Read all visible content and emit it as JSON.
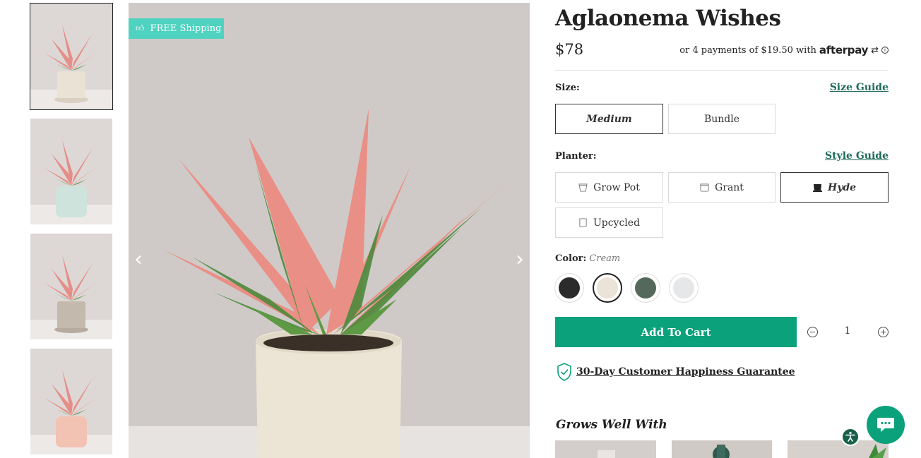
{
  "gallery": {
    "thumbnails": [
      {
        "planter_color": "#e9e2d5",
        "selected": true
      },
      {
        "planter_color": "#cfe3dd",
        "selected": false
      },
      {
        "planter_color": "#c3b9ad",
        "selected": false
      },
      {
        "planter_color": "#f2c2b2",
        "selected": false
      }
    ],
    "main_badge": "FREE Shipping",
    "prev_arrow": "‹",
    "next_arrow": "›"
  },
  "product": {
    "title": "Aglaonema Wishes",
    "price": "$78",
    "afterpay": {
      "text": "or 4 payments of $19.50 with",
      "logo": "afterpay",
      "arrows_glyph": "⇄",
      "info_glyph": "i"
    }
  },
  "size": {
    "label": "Size:",
    "guide_link": "Size Guide",
    "options": [
      "Medium",
      "Bundle"
    ],
    "selected": "Medium"
  },
  "planter": {
    "label": "Planter:",
    "guide_link": "Style Guide",
    "options": [
      "Grow Pot",
      "Grant",
      "Hyde",
      "Upcycled"
    ],
    "selected": "Hyde"
  },
  "color": {
    "label": "Color:",
    "selected_name": "Cream",
    "swatches": [
      {
        "hex": "#2b2b2b",
        "selected": false
      },
      {
        "hex": "#ebe3d8",
        "selected": true
      },
      {
        "hex": "#55695a",
        "selected": false
      },
      {
        "hex": "#e6e7e9",
        "selected": false
      }
    ]
  },
  "cart": {
    "add_label": "Add To Cart",
    "quantity": "1",
    "minus": "−",
    "plus": "+"
  },
  "guarantee": {
    "text": "30-Day Customer Happiness Guarantee"
  },
  "recommendations": {
    "title": "Grows Well With"
  },
  "colors": {
    "accent": "#0ba17b",
    "link": "#1e6b5a",
    "badge": "#4fd2c0"
  }
}
